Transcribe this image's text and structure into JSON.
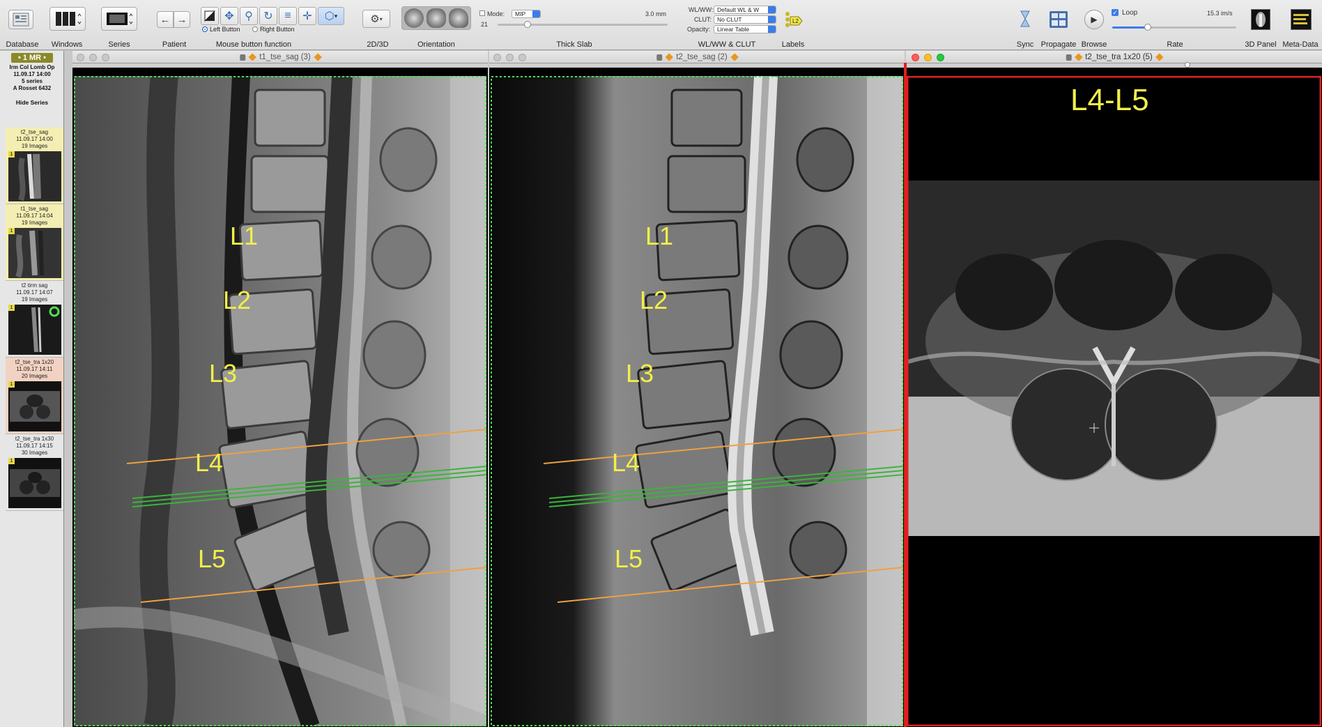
{
  "toolbar": {
    "labels": {
      "database": "Database",
      "windows": "Windows",
      "series": "Series",
      "patient": "Patient",
      "mouse": "Mouse button function",
      "twod3d": "2D/3D",
      "orientation": "Orientation",
      "thick_slab": "Thick Slab",
      "wlww": "WL/WW & CLUT",
      "labels": "Labels",
      "sync": "Sync",
      "propagate": "Propagate",
      "browse": "Browse",
      "rate": "Rate",
      "panel3d": "3D Panel",
      "metadata": "Meta-Data"
    },
    "left_button": "Left Button",
    "right_button": "Right Button",
    "mode_label": "Mode:",
    "mode_value": "MIP",
    "slab_thickness": "3.0 mm",
    "slab_count": "21",
    "wlww_label": "WL/WW:",
    "wlww_value": "Default WL & W",
    "clut_label": "CLUT:",
    "clut_value": "No CLUT",
    "opacity_label": "Opacity:",
    "opacity_value": "Linear Table",
    "loop_label": "Loop",
    "rate_value": "15.3 im/s",
    "loop_checked": true
  },
  "sidebar": {
    "badge": "• 1 MR •",
    "study_name": "Irm Col Lomb Op",
    "study_date": "11.09.17 14:00",
    "series_count": "5 series",
    "physician": "A Rosset 6432",
    "hide_series": "Hide Series",
    "series": [
      {
        "name": "t2_tse_sag",
        "date": "11.09.17 14:00",
        "images": "19 Images",
        "bg": "#f4eeb2"
      },
      {
        "name": "t1_tse_sag",
        "date": "11.09.17 14:04",
        "images": "19 Images",
        "bg": "#f4eeb2"
      },
      {
        "name": "t2 tirm sag",
        "date": "11.09.17 14:07",
        "images": "19 Images",
        "bg": "#e6e6e6"
      },
      {
        "name": "t2_tse_tra 1x20",
        "date": "11.09.17 14:11",
        "images": "20 Images",
        "bg": "#f2d2c2"
      },
      {
        "name": "t2_tse_tra 1x30",
        "date": "11.09.17 14:15",
        "images": "30 Images",
        "bg": "#e6e6e6"
      }
    ]
  },
  "viewers": [
    {
      "title": "t1_tse_sag (3)",
      "labels": [
        "L1",
        "L2",
        "L3",
        "L4",
        "L5"
      ]
    },
    {
      "title": "t2_tse_sag (2)",
      "labels": [
        "L1",
        "L2",
        "L3",
        "L4",
        "L5"
      ]
    },
    {
      "title": "t2_tse_tra 1x20 (5)",
      "labels": [
        "L4-L5"
      ]
    }
  ],
  "colors": {
    "annotation_yellow": "#f2ef4a",
    "slice_line_orange": "#f0a040",
    "slice_line_green": "#3cb43c",
    "active_border_red": "#e02020",
    "sync_border_green": "#4fe04f"
  }
}
